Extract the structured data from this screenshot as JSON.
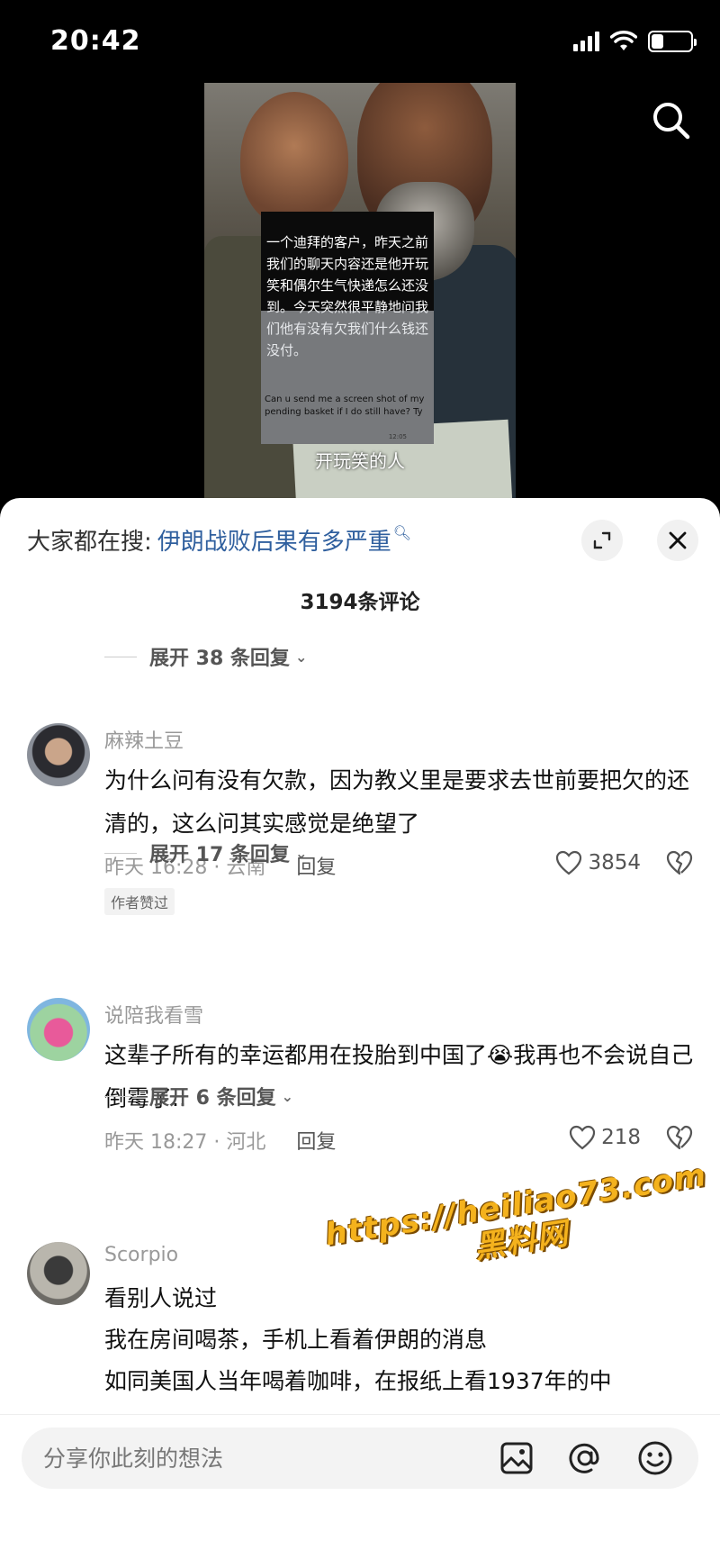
{
  "status_bar": {
    "time": "20:42"
  },
  "video": {
    "overlay_text_zh": "一个迪拜的客户，昨天之前我们的聊天内容还是他开玩笑和偶尔生气快递怎么还没到。今天突然很平静地问我们他有没有欠我们什么钱还没付。",
    "overlay_text_en": "Can u send me a screen shot of my pending basket if I do still have? Ty",
    "overlay_time": "12:05",
    "subtitle": "开玩笑的人"
  },
  "sheet": {
    "hot_search_label": "大家都在搜:",
    "hot_search_query": "伊朗战败后果有多严重",
    "comment_count": "3194条评论",
    "expand_first": "展开 38 条回复"
  },
  "comments": [
    {
      "user": "麻辣土豆",
      "text": "为什么问有没有欠款，因为教义里是要求去世前要把欠的还清的，这么问其实感觉是绝望了",
      "meta": "昨天 16:28 · 云南",
      "reply": "回复",
      "likes": "3854",
      "tag": "作者赞过",
      "expand": "展开 17 条回复"
    },
    {
      "user": "说陪我看雪",
      "text_before": "这辈子所有的幸运都用在投胎到中国了",
      "emoji": "😭",
      "text_after": "我再也不会说自己倒霉了..",
      "meta": "昨天 18:27 · 河北",
      "reply": "回复",
      "likes": "218",
      "expand": "展开 6 条回复"
    },
    {
      "user": "Scorpio",
      "line1": "看别人说过",
      "line2": "我在房间喝茶，手机上看着伊朗的消息",
      "line3": "如同美国人当年喝着咖啡，在报纸上看1937年的中"
    }
  ],
  "watermark": {
    "line1": "https://heiliao73.com",
    "line2": "黑料网"
  },
  "input": {
    "placeholder": "分享你此刻的想法"
  }
}
